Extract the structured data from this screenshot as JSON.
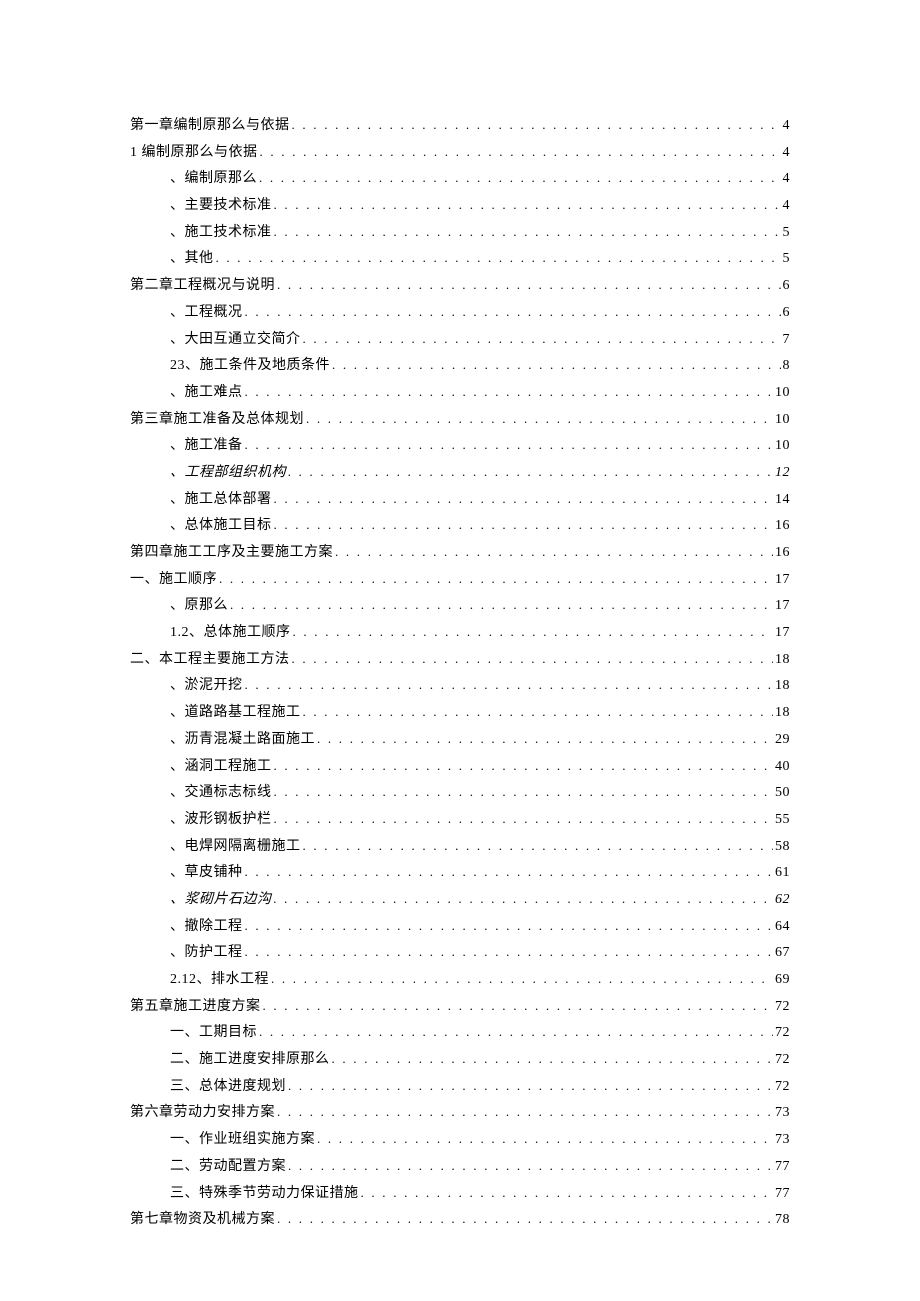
{
  "toc": [
    {
      "title": "第一章编制原那么与依据",
      "page": "4",
      "level": 0,
      "italic": false
    },
    {
      "title": "1 编制原那么与依据",
      "page": "4",
      "level": 0,
      "italic": false
    },
    {
      "title": "、编制原那么",
      "page": "4",
      "level": 1,
      "italic": false
    },
    {
      "title": "、主要技术标准",
      "page": "4",
      "level": 1,
      "italic": false
    },
    {
      "title": "、施工技术标准",
      "page": "5",
      "level": 1,
      "italic": false
    },
    {
      "title": "、其他",
      "page": "5",
      "level": 1,
      "italic": false
    },
    {
      "title": "第二章工程概况与说明",
      "page": "6",
      "level": 0,
      "italic": false
    },
    {
      "title": "、工程概况",
      "page": "6",
      "level": 1,
      "italic": false
    },
    {
      "title": "、大田互通立交简介",
      "page": "7",
      "level": 1,
      "italic": false
    },
    {
      "title": "23、施工条件及地质条件",
      "page": "8",
      "level": 1,
      "italic": false
    },
    {
      "title": "、施工难点",
      "page": "10",
      "level": 1,
      "italic": false
    },
    {
      "title": "第三章施工准备及总体规划",
      "page": "10",
      "level": 0,
      "italic": false
    },
    {
      "title": "、施工准备",
      "page": "10",
      "level": 1,
      "italic": false
    },
    {
      "title": "、工程部组织机构",
      "page": "12",
      "level": 1,
      "italic": true
    },
    {
      "title": "、施工总体部署",
      "page": "14",
      "level": 1,
      "italic": false
    },
    {
      "title": "、总体施工目标",
      "page": "16",
      "level": 1,
      "italic": false
    },
    {
      "title": "第四章施工工序及主要施工方案",
      "page": "16",
      "level": 0,
      "italic": false
    },
    {
      "title": "一、施工顺序",
      "page": "17",
      "level": 0,
      "italic": false
    },
    {
      "title": "、原那么",
      "page": "17",
      "level": 1,
      "italic": false
    },
    {
      "title": "1.2、总体施工顺序",
      "page": "17",
      "level": 1,
      "italic": false
    },
    {
      "title": "二、本工程主要施工方法",
      "page": "18",
      "level": 0,
      "italic": false
    },
    {
      "title": "、淤泥开挖",
      "page": "18",
      "level": 1,
      "italic": false
    },
    {
      "title": "、道路路基工程施工",
      "page": "18",
      "level": 1,
      "italic": false
    },
    {
      "title": "、沥青混凝土路面施工",
      "page": "29",
      "level": 1,
      "italic": false
    },
    {
      "title": "、涵洞工程施工",
      "page": "40",
      "level": 1,
      "italic": false
    },
    {
      "title": "、交通标志标线",
      "page": "50",
      "level": 1,
      "italic": false
    },
    {
      "title": "、波形钢板护栏",
      "page": "55",
      "level": 1,
      "italic": false
    },
    {
      "title": "、电焊网隔离栅施工",
      "page": "58",
      "level": 1,
      "italic": false
    },
    {
      "title": "、草皮铺种",
      "page": "61",
      "level": 1,
      "italic": false
    },
    {
      "title": "、浆砌片石边沟",
      "page": "62",
      "level": 1,
      "italic": true
    },
    {
      "title": "、撤除工程",
      "page": "64",
      "level": 1,
      "italic": false
    },
    {
      "title": "、防护工程",
      "page": "67",
      "level": 1,
      "italic": false
    },
    {
      "title": "2.12、排水工程",
      "page": "69",
      "level": 1,
      "italic": false
    },
    {
      "title": "第五章施工进度方案",
      "page": "72",
      "level": 0,
      "italic": false
    },
    {
      "title": "一、工期目标",
      "page": "72",
      "level": 1,
      "italic": false
    },
    {
      "title": "二、施工进度安排原那么",
      "page": "72",
      "level": 1,
      "italic": false
    },
    {
      "title": "三、总体进度规划",
      "page": "72",
      "level": 1,
      "italic": false
    },
    {
      "title": "第六章劳动力安排方案",
      "page": "73",
      "level": 0,
      "italic": false
    },
    {
      "title": "一、作业班组实施方案",
      "page": "73",
      "level": 1,
      "italic": false
    },
    {
      "title": "二、劳动配置方案",
      "page": "77",
      "level": 1,
      "italic": false
    },
    {
      "title": "三、特殊季节劳动力保证措施",
      "page": "77",
      "level": 1,
      "italic": false
    },
    {
      "title": "第七章物资及机械方案",
      "page": "78",
      "level": 0,
      "italic": false
    }
  ]
}
